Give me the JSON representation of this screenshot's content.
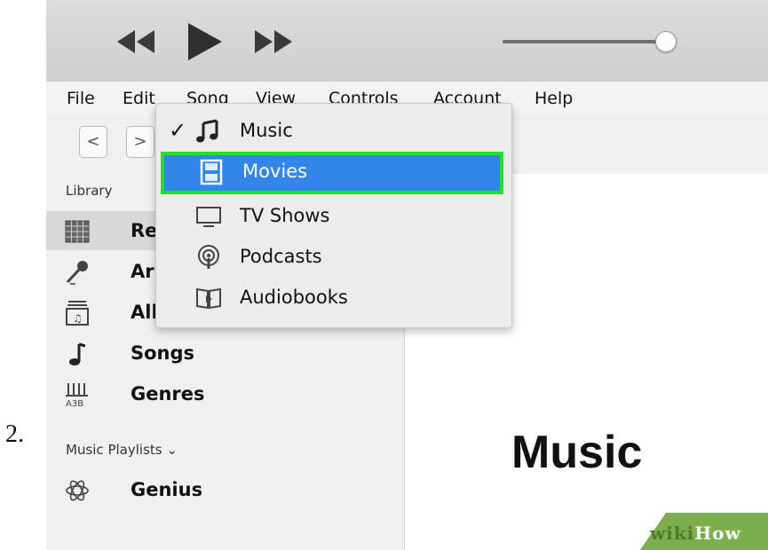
{
  "step": {
    "number": "2."
  },
  "player": {
    "rewind_icon": "rewind-icon",
    "play_icon": "play-icon",
    "fastforward_icon": "fast-forward-icon",
    "volume_level": 0.9
  },
  "menubar": {
    "items": [
      "File",
      "Edit",
      "Song",
      "View",
      "Controls",
      "Account",
      "Help"
    ]
  },
  "nav": {
    "back": "<",
    "forward": ">"
  },
  "sidebar": {
    "library_heading": "Library",
    "items": [
      {
        "label": "Recently Added",
        "visible": "Re",
        "icon": "grid-icon"
      },
      {
        "label": "Artists",
        "visible": "Ar",
        "icon": "microphone-icon"
      },
      {
        "label": "Albums",
        "visible": "All",
        "icon": "album-icon"
      },
      {
        "label": "Songs",
        "visible": "Songs",
        "icon": "music-note-icon"
      },
      {
        "label": "Genres",
        "visible": "Genres",
        "icon": "genres-icon"
      }
    ],
    "playlists_heading": "Music Playlists ⌄",
    "playlist_items": [
      {
        "label": "Genius",
        "icon": "genius-atom-icon"
      }
    ]
  },
  "dropdown": {
    "items": [
      {
        "label": "Music",
        "checked": true,
        "icon": "music-note-icon"
      },
      {
        "label": "Movies",
        "highlighted": true,
        "icon": "film-icon"
      },
      {
        "label": "TV Shows",
        "icon": "tv-icon"
      },
      {
        "label": "Podcasts",
        "icon": "podcast-icon"
      },
      {
        "label": "Audiobooks",
        "icon": "audiobook-icon"
      }
    ],
    "check_mark": "✓"
  },
  "main": {
    "title": "Music"
  },
  "watermark": {
    "part1": "wiki",
    "part2": "How"
  },
  "colors": {
    "highlight": "#3385e8",
    "highlight_border": "#24e02a",
    "watermark_green": "#7cae4c"
  }
}
